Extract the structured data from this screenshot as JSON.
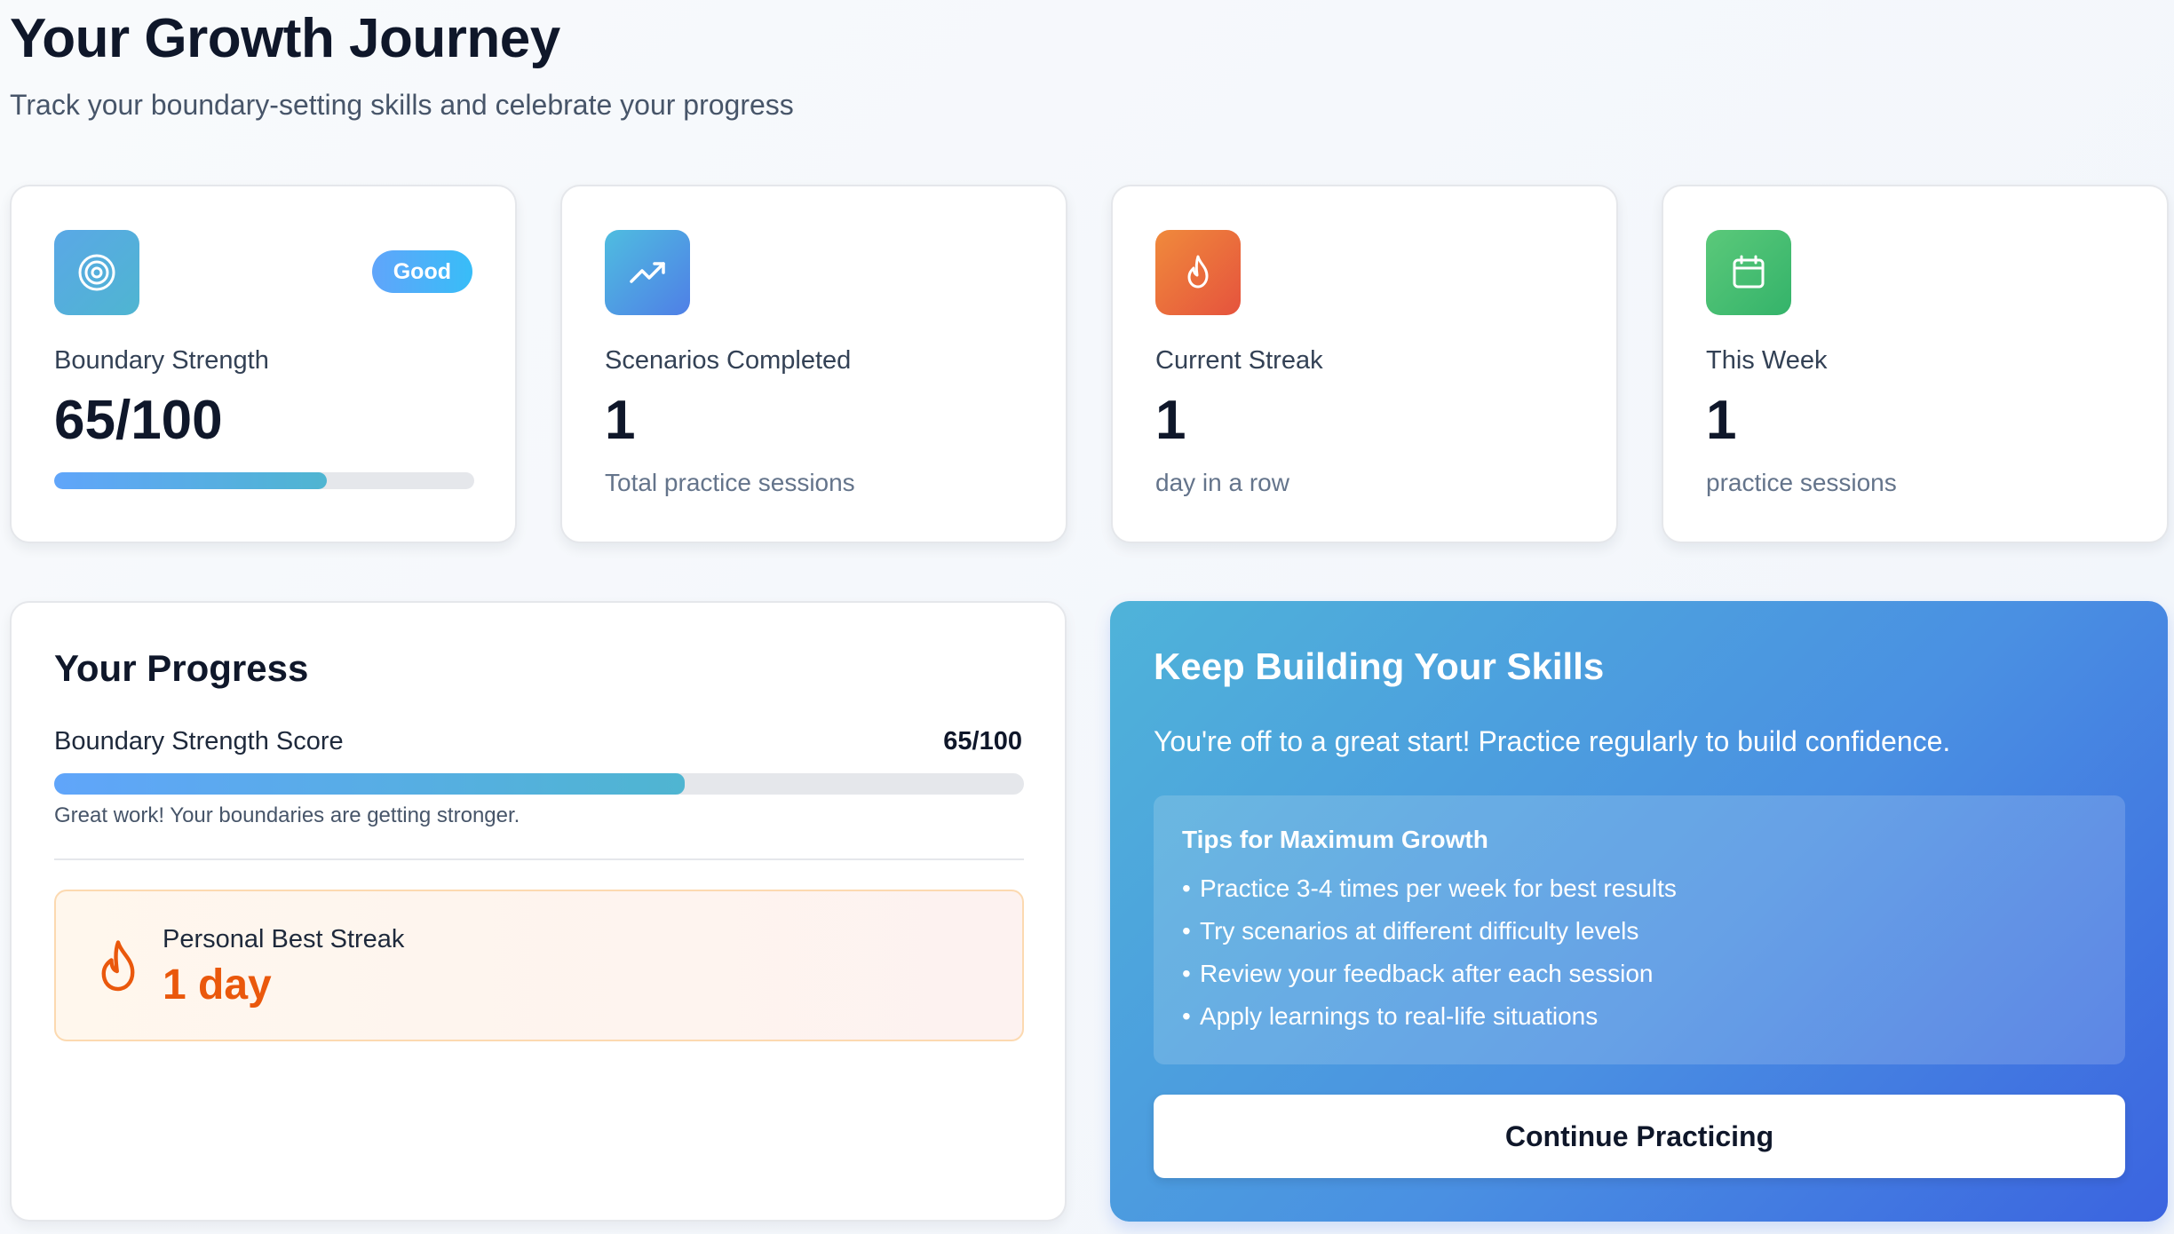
{
  "header": {
    "title": "Your Growth Journey",
    "subtitle": "Track your boundary-setting skills and celebrate your progress"
  },
  "stats": [
    {
      "icon": "target-icon",
      "label": "Boundary Strength",
      "value": "65/100",
      "badge": "Good",
      "progress_percent": 65,
      "icon_colors": [
        "#5aa8e6",
        "#4fb5d1"
      ]
    },
    {
      "icon": "trending-up-icon",
      "label": "Scenarios Completed",
      "value": "1",
      "sub": "Total practice sessions",
      "icon_colors": [
        "#4fbde0",
        "#4f7fe6"
      ]
    },
    {
      "icon": "flame-icon",
      "label": "Current Streak",
      "value": "1",
      "sub": "day in a row",
      "icon_colors": [
        "#f08a3c",
        "#e5533d"
      ]
    },
    {
      "icon": "calendar-icon",
      "label": "This Week",
      "value": "1",
      "sub": "practice sessions",
      "icon_colors": [
        "#5bc97a",
        "#34b36a"
      ]
    }
  ],
  "progress": {
    "title": "Your Progress",
    "score_label": "Boundary Strength Score",
    "score_value": "65/100",
    "score_percent": 65,
    "message": "Great work! Your boundaries are getting stronger.",
    "best_streak_label": "Personal Best Streak",
    "best_streak_value": "1 day"
  },
  "cta": {
    "title": "Keep Building Your Skills",
    "text": "You're off to a great start! Practice regularly to build confidence.",
    "tips_title": "Tips for Maximum Growth",
    "tips": [
      "Practice 3-4 times per week for best results",
      "Try scenarios at different difficulty levels",
      "Review your feedback after each session",
      "Apply learnings to real-life situations"
    ],
    "button": "Continue Practicing"
  },
  "colors": {
    "accent_orange": "#ea580c",
    "cta_gradient": [
      "#4fb3d9",
      "#3b64e0"
    ]
  }
}
